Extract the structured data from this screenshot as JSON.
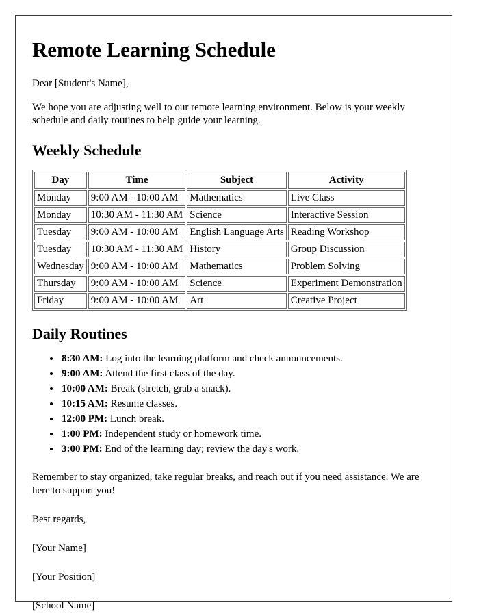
{
  "document": {
    "title": "Remote Learning Schedule",
    "salutation": "Dear [Student's Name],",
    "intro_paragraph": "We hope you are adjusting well to our remote learning environment. Below is your weekly schedule and daily routines to help guide your learning.",
    "schedule_section": {
      "heading": "Weekly Schedule",
      "columns": [
        "Day",
        "Time",
        "Subject",
        "Activity"
      ],
      "rows": [
        {
          "day": "Monday",
          "time": "9:00 AM - 10:00 AM",
          "subject": "Mathematics",
          "activity": "Live Class"
        },
        {
          "day": "Monday",
          "time": "10:30 AM - 11:30 AM",
          "subject": "Science",
          "activity": "Interactive Session"
        },
        {
          "day": "Tuesday",
          "time": "9:00 AM - 10:00 AM",
          "subject": "English Language Arts",
          "activity": "Reading Workshop"
        },
        {
          "day": "Tuesday",
          "time": "10:30 AM - 11:30 AM",
          "subject": "History",
          "activity": "Group Discussion"
        },
        {
          "day": "Wednesday",
          "time": "9:00 AM - 10:00 AM",
          "subject": "Mathematics",
          "activity": "Problem Solving"
        },
        {
          "day": "Thursday",
          "time": "9:00 AM - 10:00 AM",
          "subject": "Science",
          "activity": "Experiment Demonstration"
        },
        {
          "day": "Friday",
          "time": "9:00 AM - 10:00 AM",
          "subject": "Art",
          "activity": "Creative Project"
        }
      ]
    },
    "routines_section": {
      "heading": "Daily Routines",
      "items": [
        {
          "time": "8:30 AM:",
          "description": "Log into the learning platform and check announcements."
        },
        {
          "time": "9:00 AM:",
          "description": "Attend the first class of the day."
        },
        {
          "time": "10:00 AM:",
          "description": "Break (stretch, grab a snack)."
        },
        {
          "time": "10:15 AM:",
          "description": "Resume classes."
        },
        {
          "time": "12:00 PM:",
          "description": "Lunch break."
        },
        {
          "time": "1:00 PM:",
          "description": "Independent study or homework time."
        },
        {
          "time": "3:00 PM:",
          "description": "End of the learning day; review the day's work."
        }
      ]
    },
    "closing_paragraph": "Remember to stay organized, take regular breaks, and reach out if you need assistance. We are here to support you!",
    "sign_off": "Best regards,",
    "signature_lines": [
      "[Your Name]",
      "[Your Position]",
      "[School Name]"
    ]
  },
  "style": {
    "text_color": "#000000",
    "page_background": "#ffffff",
    "frame_border_color": "#3a3a3a",
    "table_border_color": "#6b6b6b"
  }
}
